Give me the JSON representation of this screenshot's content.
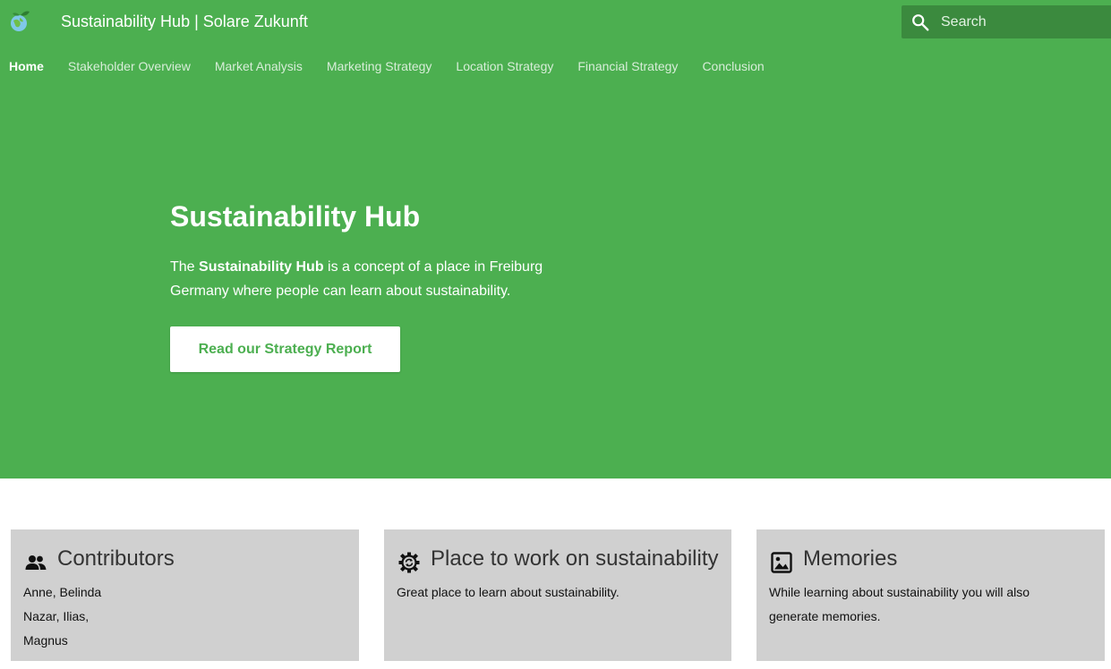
{
  "header": {
    "logo": "globe-leaf-icon",
    "title": "Sustainability Hub | Solare Zukunft",
    "search": {
      "placeholder": "Search",
      "icon": "search-icon"
    }
  },
  "nav": {
    "tabs": [
      {
        "label": "Home",
        "active": true
      },
      {
        "label": "Stakeholder Overview",
        "active": false
      },
      {
        "label": "Market Analysis",
        "active": false
      },
      {
        "label": "Marketing Strategy",
        "active": false
      },
      {
        "label": "Location Strategy",
        "active": false
      },
      {
        "label": "Financial Strategy",
        "active": false
      },
      {
        "label": "Conclusion",
        "active": false
      }
    ]
  },
  "hero": {
    "title": "Sustainability Hub",
    "text_before": "The ",
    "text_bold": "Sustainability Hub",
    "text_after": " is a concept of a place in Freiburg Germany where people can learn about sustainability.",
    "button_label": "Read our Strategy Report"
  },
  "cards": [
    {
      "icon": "group-icon",
      "title": "Contributors",
      "lines": [
        "Anne, Belinda",
        "Nazar, Ilias,",
        "Magnus"
      ]
    },
    {
      "icon": "gear-sync-icon",
      "title": "Place to work on sustainability",
      "lines": [
        "Great place to learn about sustainability."
      ]
    },
    {
      "icon": "image-icon",
      "title": "Memories",
      "lines": [
        "While learning about sustainability you will also",
        "generate memories."
      ]
    }
  ],
  "colors": {
    "primary": "#4caf50",
    "search_bg": "#3b8a3e",
    "card_bg": "#d0d0d0"
  }
}
